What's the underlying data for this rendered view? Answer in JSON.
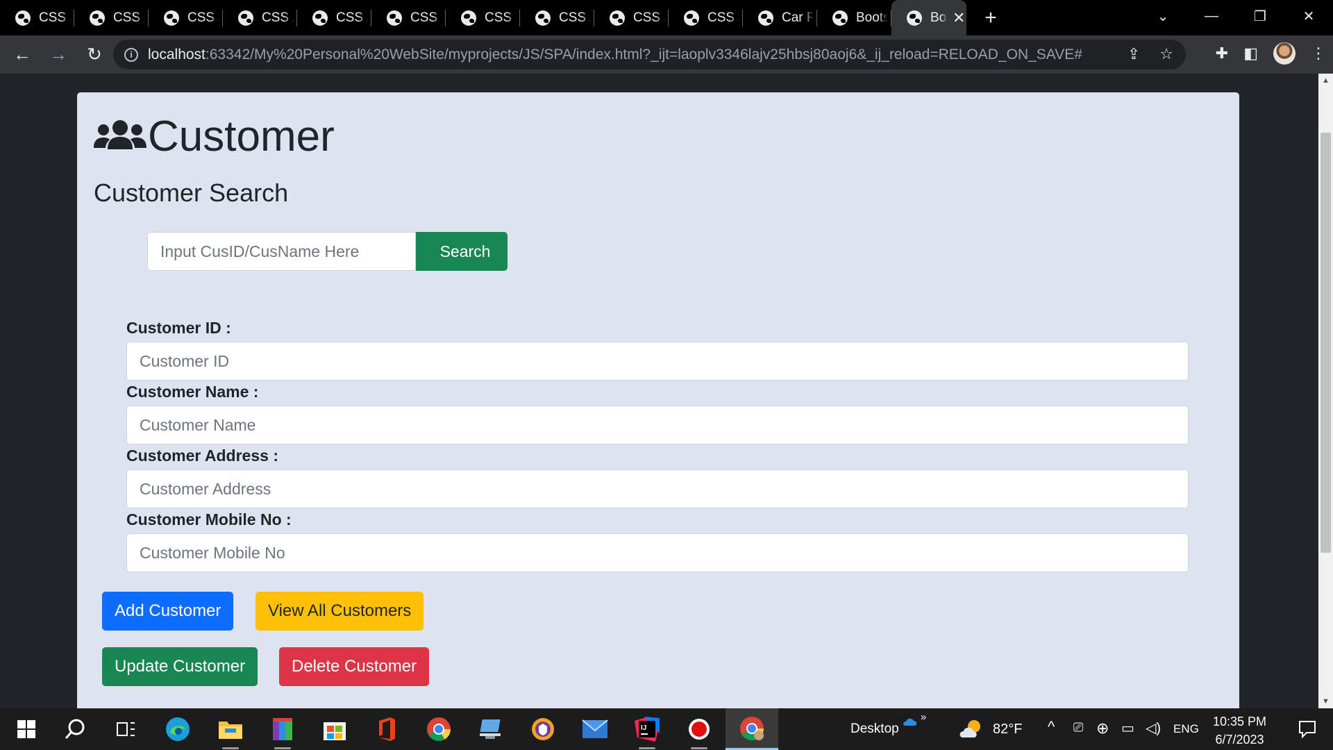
{
  "browser": {
    "tabs": [
      {
        "title": "CSS A"
      },
      {
        "title": "CSS A"
      },
      {
        "title": "CSS A"
      },
      {
        "title": "CSS A"
      },
      {
        "title": "CSS A"
      },
      {
        "title": "CSS Tr"
      },
      {
        "title": "CSS Tr"
      },
      {
        "title": "CSS A"
      },
      {
        "title": "CSS A"
      },
      {
        "title": "CSS A"
      },
      {
        "title": "Car Re"
      },
      {
        "title": "Boots"
      },
      {
        "title": "Bo",
        "active": true
      }
    ],
    "new_tab_label": "+",
    "url_host": "localhost",
    "url_rest": ":63342/My%20Personal%20WebSite/myprojects/JS/SPA/index.html?_ijt=laoplv3346lajv25hbsj80aoj6&_ij_reload=RELOAD_ON_SAVE#"
  },
  "page": {
    "title": "Customer",
    "search_section_title": "Customer Search",
    "search": {
      "placeholder": "Input CusID/CusName Here",
      "value": "",
      "button_label": "Search"
    },
    "fields": [
      {
        "label": "Customer ID :",
        "placeholder": "Customer ID",
        "value": ""
      },
      {
        "label": "Customer Name :",
        "placeholder": "Customer Name",
        "value": ""
      },
      {
        "label": "Customer Address :",
        "placeholder": "Customer Address",
        "value": ""
      },
      {
        "label": "Customer Mobile No :",
        "placeholder": "Customer Mobile No",
        "value": ""
      }
    ],
    "buttons": {
      "add": "Add Customer",
      "view_all": "View All Customers",
      "update": "Update Customer",
      "delete": "Delete Customer"
    },
    "colors": {
      "primary": "#0d6efd",
      "warning": "#ffc107",
      "success": "#198754",
      "danger": "#dc3545",
      "card_bg": "#dde4ef",
      "page_bg": "#212529"
    }
  },
  "taskbar": {
    "desktop_label": "Desktop",
    "weather": "82°F",
    "language": "ENG",
    "time": "10:35 PM",
    "date": "6/7/2023",
    "apps": [
      "start-icon",
      "search-icon",
      "task-view-icon",
      "edge-icon",
      "file-explorer-icon",
      "winrar-icon",
      "microsoft-store-icon",
      "office-icon",
      "chrome-icon",
      "network-app-icon",
      "vpn-icon",
      "mail-icon",
      "intellij-icon",
      "recorder-icon",
      "chrome-profile-icon"
    ]
  }
}
